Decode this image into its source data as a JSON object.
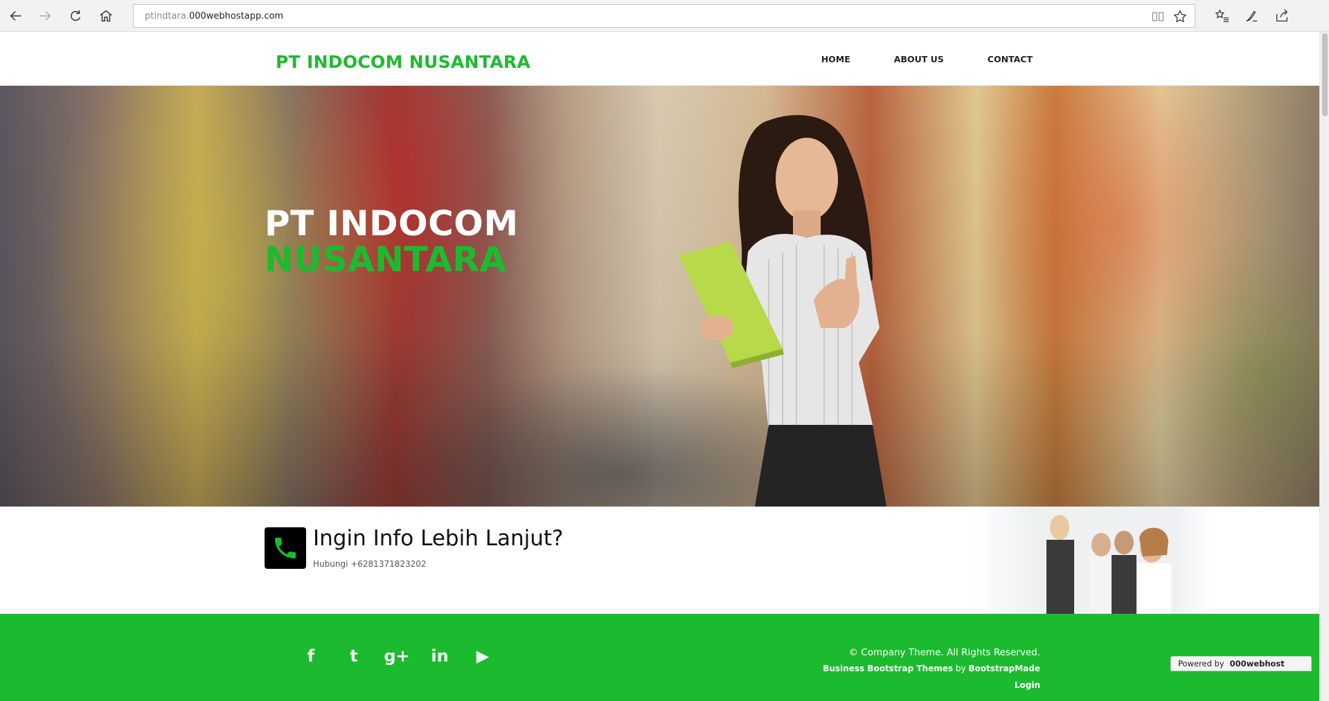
{
  "browser": {
    "url_dim": "ptindtara.",
    "url_main": "000webhostapp.com",
    "icons": [
      "back-icon",
      "forward-icon",
      "refresh-icon",
      "home-icon",
      "reading-view-icon",
      "favorite-star-icon",
      "favorites-list-icon",
      "pen-icon",
      "share-icon"
    ]
  },
  "header": {
    "brand": "PT INDOCOM NUSANTARA",
    "nav": [
      "HOME",
      "ABOUT US",
      "CONTACT"
    ]
  },
  "hero": {
    "title_line1": "PT INDOCOM",
    "title_line2": "NUSANTARA"
  },
  "cta": {
    "title": "Ingin Info Lebih Lanjut?",
    "subtitle": "Hubungi +6281371823202"
  },
  "footer": {
    "social": [
      "f",
      "t",
      "g+",
      "in",
      "▶"
    ],
    "copyright": "© Company Theme. All Rights Reserved.",
    "credit_themes": "Business Bootstrap Themes",
    "credit_by": "by",
    "credit_brand": "BootstrapMade",
    "login": "Login"
  },
  "badge": {
    "powered": "Powered by",
    "brand": "000webhost"
  },
  "colors": {
    "accent_green": "#1cbb2f"
  }
}
